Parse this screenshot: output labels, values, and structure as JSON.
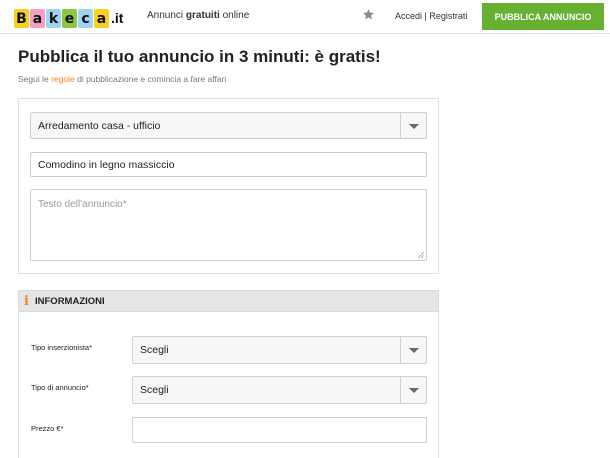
{
  "header": {
    "logo": {
      "letters": [
        {
          "char": "B",
          "color": "#f7d11e"
        },
        {
          "char": "a",
          "color": "#f59fc4"
        },
        {
          "char": "k",
          "color": "#9fd4f2"
        },
        {
          "char": "e",
          "color": "#8ec641"
        },
        {
          "char": "c",
          "color": "#9fd4f2"
        },
        {
          "char": "a",
          "color": "#f7d11e"
        }
      ],
      "tld": ".it"
    },
    "tagline_prefix": "Annunci ",
    "tagline_bold": "gratuiti",
    "tagline_suffix": " online",
    "login_link": "Accedi | Registrati",
    "publish_button": "PUBBLICA ANNUNCIO",
    "accent_color": "#66b032"
  },
  "page": {
    "title": "Pubblica il tuo annuncio in 3 minuti: è gratis!",
    "subtitle_prefix": "Segui le ",
    "subtitle_link": "regole",
    "subtitle_suffix": " di pubblicazione e comincia a fare affari",
    "link_color": "#ff7f1a"
  },
  "form": {
    "category_value": "Arredamento casa - ufficio",
    "title_value": "Comodino in legno massiccio",
    "text_placeholder": "Testo dell'annuncio*"
  },
  "info": {
    "icon": "i",
    "title": "INFORMAZIONI",
    "advertiser_type_label": "Tipo inserzionista*",
    "advertiser_type_value": "Scegli",
    "ad_type_label": "Tipo di annuncio*",
    "ad_type_value": "Scegli",
    "price_label": "Prezzo €*",
    "price_value": ""
  },
  "icons": {
    "favorites": "star-icon",
    "dropdown": "chevron-down-icon",
    "info": "info-icon",
    "resize": "resize-grip-icon"
  }
}
